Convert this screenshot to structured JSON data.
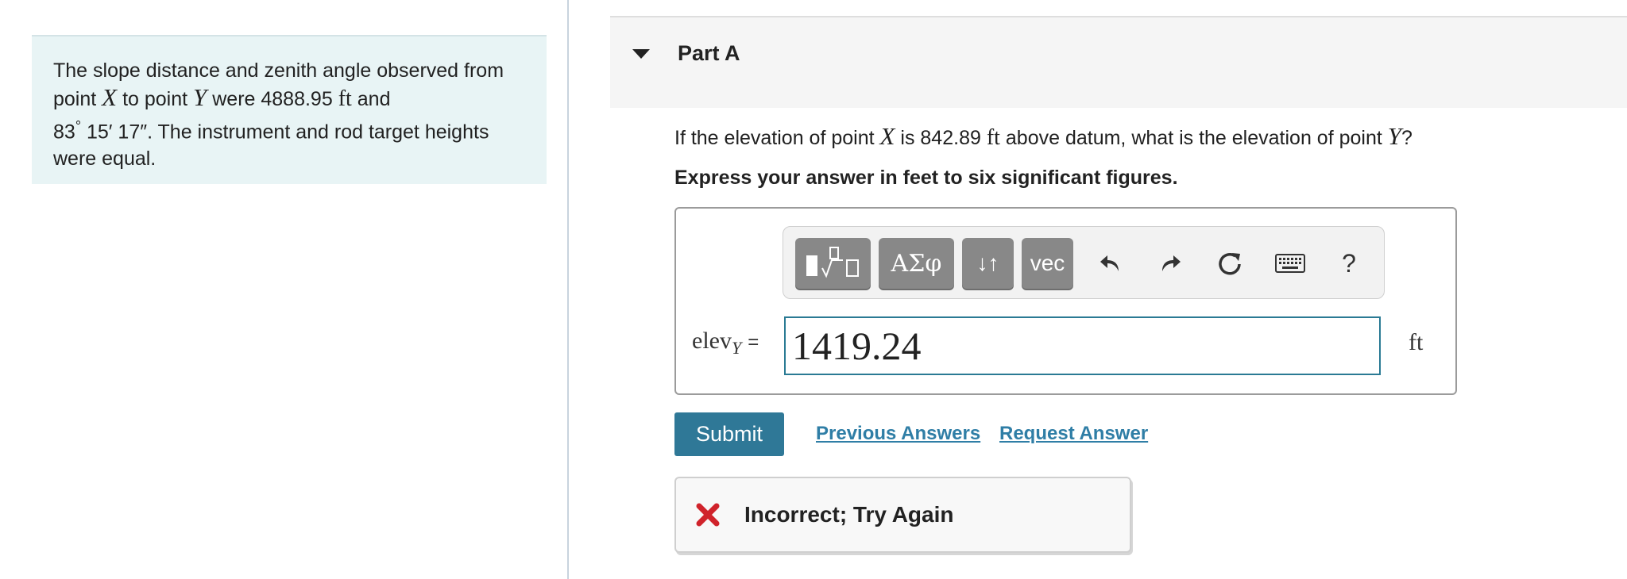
{
  "problem": {
    "t1": "The slope distance and zenith angle observed from",
    "t2": "point",
    "var_x": "X",
    "t3": "to point",
    "var_y": "Y",
    "t4": "were 4888.95",
    "unit_ft": "ft",
    "t5": "and",
    "deg": "83",
    "deg_sym": "°",
    "min": "15",
    "min_sym": "′",
    "sec": "17",
    "sec_sym": "″",
    "t6": ". The instrument and rod target heights",
    "t7": "were equal."
  },
  "part": {
    "title": "Part A"
  },
  "question": {
    "q1": "If the elevation of point",
    "var_x": "X",
    "q2": "is 842.89",
    "unit_ft": "ft",
    "q3": "above datum, what is the elevation of point",
    "var_y": "Y",
    "q4": "?",
    "instruction": "Express your answer in feet to six significant figures."
  },
  "toolbar": {
    "greek_label": "ΑΣφ",
    "arrows_label": "↓↑",
    "vec_label": "vec",
    "help_label": "?",
    "icons": [
      "templates-icon",
      "undo-icon",
      "redo-icon",
      "reset-icon",
      "keyboard-icon",
      "help-icon"
    ]
  },
  "answer": {
    "label_main": "elev",
    "label_sub": "Y",
    "equals": "=",
    "value": "1419.24",
    "unit": "ft"
  },
  "actions": {
    "submit_label": "Submit",
    "previous_label": "Previous Answers",
    "request_label": "Request Answer"
  },
  "feedback": {
    "text": "Incorrect; Try Again",
    "color": "#d0232b"
  }
}
